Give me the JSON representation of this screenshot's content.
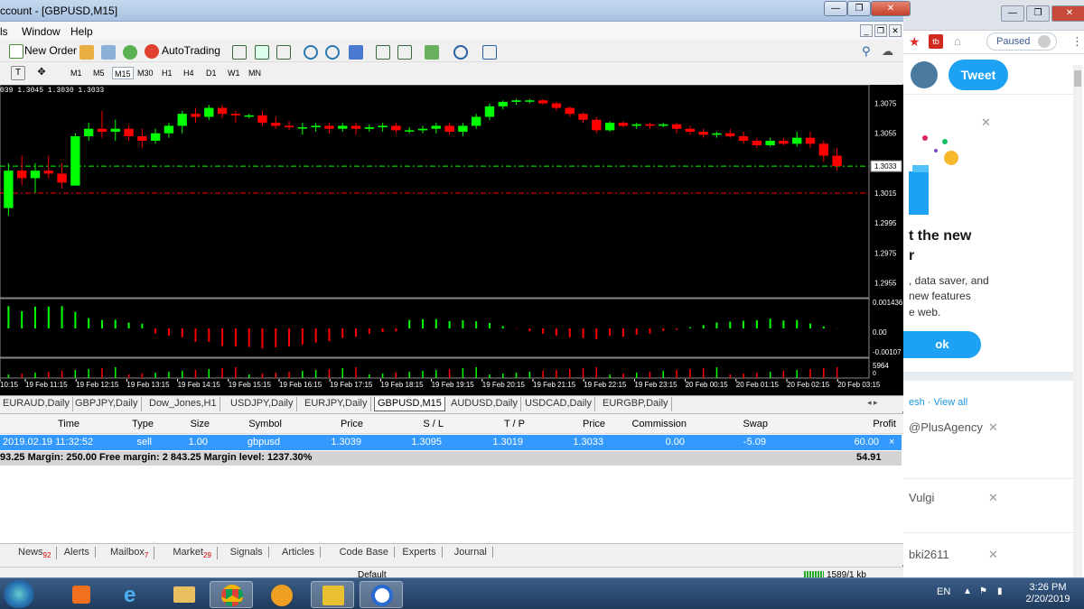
{
  "window": {
    "title": "ccount - [GBPUSD,M15]",
    "menus": [
      "ls",
      "Window",
      "Help"
    ]
  },
  "toolbar": {
    "new_order": "New Order",
    "autotrading": "AutoTrading",
    "timeframes": [
      "M1",
      "M5",
      "M15",
      "M30",
      "H1",
      "H4",
      "D1",
      "W1",
      "MN"
    ],
    "active_timeframe": "M15"
  },
  "chart": {
    "ohlc_header": "039 1.3045 1.3030 1.3033",
    "symbol": "GBPUSD",
    "timeframe": "M15",
    "current_price": "1.3033",
    "price_ticks": [
      "1.3075",
      "1.3055",
      "1.3033",
      "1.3015",
      "1.2995",
      "1.2975",
      "1.2955"
    ],
    "osc_ticks": [
      "0.001436",
      "0.00",
      "-0.00107"
    ],
    "vol_tick": "5964",
    "vol_tick2": "0",
    "time_ticks": [
      "10:15",
      "19 Feb 11:15",
      "19 Feb 12:15",
      "19 Feb 13:15",
      "19 Feb 14:15",
      "19 Feb 15:15",
      "19 Feb 16:15",
      "19 Feb 17:15",
      "19 Feb 18:15",
      "19 Feb 19:15",
      "19 Feb 20:15",
      "19 Feb 21:15",
      "19 Feb 22:15",
      "19 Feb 23:15",
      "20 Feb 00:15",
      "20 Feb 01:15",
      "20 Feb 02:15",
      "20 Feb 03:15"
    ],
    "colors": {
      "up": "#00ff00",
      "down": "#ff0000",
      "bg": "#000000",
      "grid_line": "#00ff00"
    }
  },
  "chart_data": {
    "type": "candlestick",
    "title": "GBPUSD,M15",
    "xlabel": "",
    "ylabel": "",
    "ylim": [
      1.2945,
      1.3085
    ],
    "candles": [
      [
        1.3005,
        1.3035,
        1.3,
        1.303
      ],
      [
        1.303,
        1.304,
        1.302,
        1.3025
      ],
      [
        1.3025,
        1.3035,
        1.3015,
        1.303
      ],
      [
        1.303,
        1.304,
        1.3025,
        1.3028
      ],
      [
        1.3028,
        1.3035,
        1.3018,
        1.3022
      ],
      [
        1.302,
        1.3055,
        1.302,
        1.3053
      ],
      [
        1.3053,
        1.3062,
        1.305,
        1.3058
      ],
      [
        1.3058,
        1.307,
        1.3052,
        1.3056
      ],
      [
        1.3056,
        1.3064,
        1.305,
        1.3058
      ],
      [
        1.3058,
        1.306,
        1.305,
        1.3053
      ],
      [
        1.3053,
        1.3058,
        1.3045,
        1.305
      ],
      [
        1.305,
        1.3058,
        1.3048,
        1.3055
      ],
      [
        1.3055,
        1.3062,
        1.3052,
        1.306
      ],
      [
        1.306,
        1.307,
        1.3055,
        1.3068
      ],
      [
        1.3068,
        1.3072,
        1.3062,
        1.3066
      ],
      [
        1.3066,
        1.3074,
        1.3064,
        1.3072
      ],
      [
        1.3072,
        1.3074,
        1.3065,
        1.3068
      ],
      [
        1.3068,
        1.307,
        1.3062,
        1.3067
      ],
      [
        1.3067,
        1.3068,
        1.3065,
        1.3067
      ],
      [
        1.3067,
        1.307,
        1.306,
        1.3062
      ],
      [
        1.3062,
        1.3066,
        1.3058,
        1.306
      ],
      [
        1.306,
        1.3063,
        1.3057,
        1.3059
      ],
      [
        1.3059,
        1.3062,
        1.3054,
        1.3059
      ],
      [
        1.3059,
        1.3062,
        1.3056,
        1.306
      ],
      [
        1.306,
        1.3062,
        1.3055,
        1.3058
      ],
      [
        1.3058,
        1.3062,
        1.3056,
        1.306
      ],
      [
        1.306,
        1.3062,
        1.3054,
        1.3058
      ],
      [
        1.3058,
        1.3061,
        1.3056,
        1.3059
      ],
      [
        1.3059,
        1.3062,
        1.3056,
        1.306
      ],
      [
        1.306,
        1.3062,
        1.3055,
        1.3057
      ],
      [
        1.3057,
        1.3059,
        1.3055,
        1.3057
      ],
      [
        1.3057,
        1.306,
        1.3055,
        1.3058
      ],
      [
        1.3058,
        1.3062,
        1.3055,
        1.306
      ],
      [
        1.306,
        1.3062,
        1.3054,
        1.3056
      ],
      [
        1.3056,
        1.3062,
        1.3053,
        1.306
      ],
      [
        1.306,
        1.3068,
        1.3058,
        1.3066
      ],
      [
        1.3066,
        1.3075,
        1.3064,
        1.3073
      ],
      [
        1.3073,
        1.3077,
        1.3071,
        1.3076
      ],
      [
        1.3076,
        1.3078,
        1.3074,
        1.3077
      ],
      [
        1.3077,
        1.3078,
        1.3075,
        1.3077
      ],
      [
        1.3077,
        1.3078,
        1.3074,
        1.3075
      ],
      [
        1.3075,
        1.3076,
        1.307,
        1.3072
      ],
      [
        1.3072,
        1.3073,
        1.3066,
        1.3068
      ],
      [
        1.3068,
        1.3069,
        1.3062,
        1.3064
      ],
      [
        1.3064,
        1.3066,
        1.3055,
        1.3057
      ],
      [
        1.3057,
        1.3063,
        1.3056,
        1.3062
      ],
      [
        1.3062,
        1.3063,
        1.3059,
        1.306
      ],
      [
        1.306,
        1.3062,
        1.3058,
        1.3061
      ],
      [
        1.3061,
        1.3062,
        1.3058,
        1.306
      ],
      [
        1.306,
        1.3062,
        1.3059,
        1.3061
      ],
      [
        1.3061,
        1.3062,
        1.3055,
        1.3058
      ],
      [
        1.3058,
        1.306,
        1.3054,
        1.3056
      ],
      [
        1.3056,
        1.3058,
        1.3052,
        1.3054
      ],
      [
        1.3054,
        1.3056,
        1.3052,
        1.3055
      ],
      [
        1.3055,
        1.3058,
        1.3052,
        1.3053
      ],
      [
        1.3053,
        1.3056,
        1.3048,
        1.305
      ],
      [
        1.305,
        1.3052,
        1.3045,
        1.3047
      ],
      [
        1.3047,
        1.3052,
        1.3046,
        1.305
      ],
      [
        1.305,
        1.3052,
        1.3047,
        1.3048
      ],
      [
        1.3048,
        1.3056,
        1.3046,
        1.3052
      ],
      [
        1.3052,
        1.3056,
        1.3045,
        1.3048
      ],
      [
        1.3048,
        1.305,
        1.3036,
        1.304
      ],
      [
        1.304,
        1.3045,
        1.303,
        1.3033
      ]
    ],
    "bid_line": 1.3033,
    "sl_line": 1.3015
  },
  "chart_tabs": [
    "EURAUD,Daily",
    "GBPJPY,Daily",
    "Dow_Jones,H1",
    "USDJPY,Daily",
    "EURJPY,Daily",
    "GBPUSD,M15",
    "AUDUSD,Daily",
    "USDCAD,Daily",
    "EURGBP,Daily"
  ],
  "active_chart_tab": "GBPUSD,M15",
  "terminal": {
    "headers": [
      "Time",
      "Type",
      "Size",
      "Symbol",
      "Price",
      "S / L",
      "T / P",
      "Price",
      "Commission",
      "Swap",
      "Profit"
    ],
    "row": [
      "2019.02.19 11:32:52",
      "sell",
      "1.00",
      "gbpusd",
      "1.3039",
      "1.3095",
      "1.3019",
      "1.3033",
      "0.00",
      "-5.09",
      "60.00"
    ],
    "balance_line": "93.25  Margin: 250.00  Free margin: 2 843.25  Margin level: 1237.30%",
    "balance_profit": "54.91",
    "tabs": [
      {
        "label": "News",
        "badge": "92"
      },
      {
        "label": "Alerts",
        "badge": ""
      },
      {
        "label": "Mailbox",
        "badge": "7"
      },
      {
        "label": "Market",
        "badge": "29"
      },
      {
        "label": "Signals",
        "badge": ""
      },
      {
        "label": "Articles",
        "badge": ""
      },
      {
        "label": "Code Base",
        "badge": ""
      },
      {
        "label": "Experts",
        "badge": ""
      },
      {
        "label": "Journal",
        "badge": ""
      }
    ],
    "status_left": "Default",
    "status_right": "1589/1 kb"
  },
  "browser": {
    "paused": "Paused",
    "tweet": "Tweet",
    "promo_title_1": "t the new",
    "promo_title_2": "r",
    "promo_text_1": ", data saver, and",
    "promo_text_2": "new features",
    "promo_text_3": "e web.",
    "promo_btn": "ok",
    "refresh_link": "esh · View all",
    "users": [
      "@PlusAgency",
      "Vulgi",
      "bki2611"
    ]
  },
  "taskbar": {
    "lang": "EN",
    "time": "3:26 PM",
    "date": "2/20/2019"
  }
}
